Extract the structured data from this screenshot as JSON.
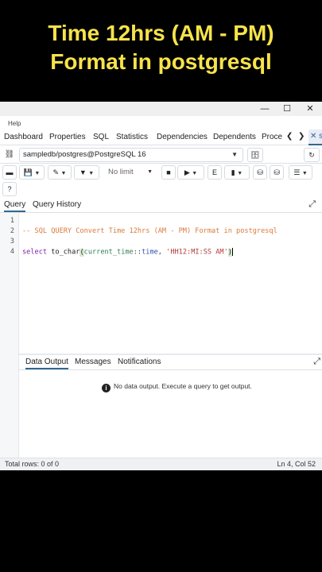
{
  "banner": {
    "line1": "Time 12hrs (AM - PM)",
    "line2": "Format in postgresql",
    "color": "#f7e34a"
  },
  "window": {
    "minimize": "—",
    "maximize": "☐",
    "close": "✕"
  },
  "menu": {
    "help": "Help"
  },
  "tabs": {
    "items": [
      "Dashboard",
      "Properties",
      "SQL",
      "Statistics",
      "Dependencies",
      "Dependents",
      "Proce"
    ],
    "prev": "❮",
    "next": "❯",
    "active_close": "✕ sa"
  },
  "connection": {
    "value": "sampledb/postgres@PostgreSQL 16"
  },
  "toolbar": {
    "limit": "No limit"
  },
  "query_tabs": {
    "query": "Query",
    "history": "Query History"
  },
  "editor": {
    "line_numbers": [
      "1",
      "2",
      "3",
      "4"
    ],
    "line2": "-- SQL QUERY Convert Time 12hrs (AM - PM) Format in postgresql",
    "line4": {
      "kw": "select",
      "fn": "to_char",
      "open": "(",
      "var": "current_time",
      "op": "::",
      "type": "time",
      "sep": ", ",
      "str": "'HH12:MI:SS AM'",
      "close": ")"
    }
  },
  "output_tabs": {
    "data_output": "Data Output",
    "messages": "Messages",
    "notifications": "Notifications"
  },
  "output": {
    "message": "No data output. Execute a query to get output."
  },
  "status": {
    "rows": "Total rows: 0 of 0",
    "position": "Ln 4, Col 52"
  }
}
